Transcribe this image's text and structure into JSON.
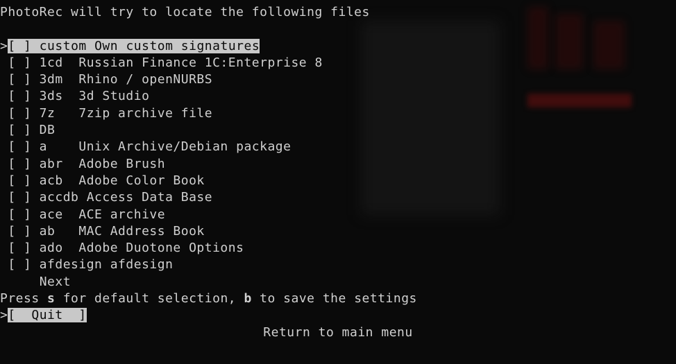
{
  "header": "PhotoRec will try to locate the following files",
  "cursor_prefix": ">",
  "bracket_left": "[",
  "bracket_right": "]",
  "checkbox_unchecked": " ",
  "selected_entry": {
    "ext": "custom",
    "desc": "Own custom signatures"
  },
  "entries": [
    {
      "ext": "1cd",
      "desc": "Russian Finance 1C:Enterprise 8"
    },
    {
      "ext": "3dm",
      "desc": "Rhino / openNURBS"
    },
    {
      "ext": "3ds",
      "desc": "3d Studio"
    },
    {
      "ext": "7z",
      "desc": "7zip archive file"
    },
    {
      "ext": "DB",
      "desc": ""
    },
    {
      "ext": "a",
      "desc": "Unix Archive/Debian package"
    },
    {
      "ext": "abr",
      "desc": "Adobe Brush"
    },
    {
      "ext": "acb",
      "desc": "Adobe Color Book"
    },
    {
      "ext": "accdb",
      "desc": "Access Data Base"
    },
    {
      "ext": "ace",
      "desc": "ACE archive"
    },
    {
      "ext": "ab",
      "desc": "MAC Address Book"
    },
    {
      "ext": "ado",
      "desc": "Adobe Duotone Options"
    },
    {
      "ext": "afdesign",
      "desc": "afdesign"
    }
  ],
  "next_label": "Next",
  "help_prefix": "Press ",
  "help_key1": "s",
  "help_mid": " for default selection, ",
  "help_key2": "b",
  "help_suffix": " to save the settings",
  "quit_label": "Quit",
  "footer": "Return to main menu"
}
